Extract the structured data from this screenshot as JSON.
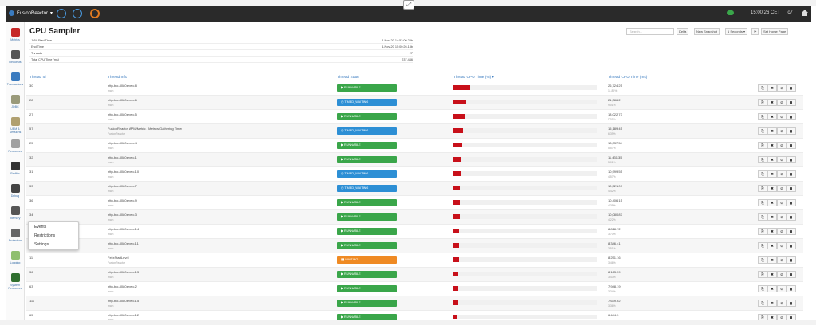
{
  "topbar": {
    "app_name": "FusionReactor",
    "clock": "15:00:26 CET",
    "user": "ic7"
  },
  "sidebar": {
    "items": [
      {
        "label": "Metrics",
        "icon": "metrics-icon",
        "color": "#c62828"
      },
      {
        "label": "Requests",
        "icon": "requests-icon",
        "color": "#555555"
      },
      {
        "label": "Transactions",
        "icon": "transactions-icon",
        "color": "#3a7bbf"
      },
      {
        "label": "JDBC",
        "icon": "jdbc-icon",
        "color": "#9a9a7a"
      },
      {
        "label": "UEM & Sessions",
        "icon": "uem-icon",
        "color": "#b0a070"
      },
      {
        "label": "Resources",
        "icon": "resources-icon",
        "color": "#a0a0a0"
      },
      {
        "label": "Profiler",
        "icon": "profiler-icon",
        "color": "#333333"
      },
      {
        "label": "Debug",
        "icon": "debug-icon",
        "color": "#444444"
      },
      {
        "label": "Memory",
        "icon": "memory-icon",
        "color": "#555555"
      },
      {
        "label": "Protection",
        "icon": "protection-icon",
        "color": "#666666"
      },
      {
        "label": "Logging",
        "icon": "logging-icon",
        "color": "#8fbf6f"
      },
      {
        "label": "System Resources",
        "icon": "system-resources-icon",
        "color": "#2f6f2f"
      }
    ]
  },
  "page": {
    "title": "CPU Sampler",
    "search_placeholder": "Search...",
    "toolbar": {
      "delta": "Delta",
      "new_snapshot": "New Snapshot",
      "interval": "1 Seconds ▾",
      "refresh": "⟳",
      "set_home": "Set Home Page"
    }
  },
  "stats": [
    {
      "label": "JVM Start Time",
      "value": "4-Nov-20 14:53:00.23b"
    },
    {
      "label": "End Time",
      "value": "4-Nov-20 15:00:26.13b"
    },
    {
      "label": "Threads",
      "value": "27"
    },
    {
      "label": "Total CPU Time (ms)",
      "value": "237,446"
    }
  ],
  "table": {
    "headers": {
      "thread_id": "Thread Id",
      "thread_info": "Thread Info",
      "thread_state": "Thread State",
      "thread_cpu_pct": "Thread CPU Time (%) ▾",
      "thread_cpu_ms": "Thread CPU Time (ms)"
    },
    "rows": [
      {
        "id": "30",
        "name": "http-bio-8080-exec-8",
        "group": "main",
        "state": "RUNNABLE",
        "state_kind": "run",
        "pct": 0.119,
        "time": "26,724.25",
        "pct_label": "11.85%"
      },
      {
        "id": "28",
        "name": "http-bio-8080-exec-6",
        "group": "main",
        "state": "TIMED_WAITING",
        "state_kind": "tw",
        "pct": 0.09,
        "time": "21,386.2",
        "pct_label": "9.01%"
      },
      {
        "id": "27",
        "name": "http-bio-8080-exec-5",
        "group": "main",
        "state": "RUNNABLE",
        "state_kind": "run",
        "pct": 0.08,
        "time": "18,022.73",
        "pct_label": "7.99%"
      },
      {
        "id": "57",
        "name": "FusionReactor APM/Metric - Metrics Gathering Timer",
        "group": "FusionReactor",
        "state": "TIMED_WAITING",
        "state_kind": "tw",
        "pct": 0.067,
        "time": "15,189.45",
        "pct_label": "6.39%"
      },
      {
        "id": "25",
        "name": "http-bio-8080-exec-4",
        "group": "main",
        "state": "RUNNABLE",
        "state_kind": "run",
        "pct": 0.059,
        "time": "13,337.54",
        "pct_label": "5.57%"
      },
      {
        "id": "32",
        "name": "http-bio-8080-exec-1",
        "group": "main",
        "state": "RUNNABLE",
        "state_kind": "run",
        "pct": 0.051,
        "time": "11,431.35",
        "pct_label": "5.01%"
      },
      {
        "id": "31",
        "name": "http-bio-8080-exec-10",
        "group": "main",
        "state": "TIMED_WAITING",
        "state_kind": "tw",
        "pct": 0.049,
        "time": "10,999.55",
        "pct_label": "4.57%"
      },
      {
        "id": "33",
        "name": "http-bio-8080-exec-7",
        "group": "main",
        "state": "TIMED_WAITING",
        "state_kind": "tw",
        "pct": 0.047,
        "time": "10,521.09",
        "pct_label": "4.42%"
      },
      {
        "id": "36",
        "name": "http-bio-8080-exec-9",
        "group": "main",
        "state": "RUNNABLE",
        "state_kind": "run",
        "pct": 0.047,
        "time": "10,406.15",
        "pct_label": "4.39%"
      },
      {
        "id": "34",
        "name": "http-bio-8080-exec-3",
        "group": "main",
        "state": "RUNNABLE",
        "state_kind": "run",
        "pct": 0.045,
        "time": "10,080.87",
        "pct_label": "4.22%"
      },
      {
        "id": "39",
        "name": "http-bio-8080-exec-14",
        "group": "main",
        "state": "RUNNABLE",
        "state_kind": "run",
        "pct": 0.039,
        "time": "8,818.72",
        "pct_label": "3.70%"
      },
      {
        "id": "33",
        "name": "http-bio-8080-exec-11",
        "group": "main",
        "state": "RUNNABLE",
        "state_kind": "run",
        "pct": 0.037,
        "time": "8,346.41",
        "pct_label": "3.51%"
      },
      {
        "id": "11",
        "name": "FelixStartLevel",
        "group": "FusionReactor",
        "state": "WAITING",
        "state_kind": "wait",
        "pct": 0.037,
        "time": "8,251.16",
        "pct_label": "3.46%"
      },
      {
        "id": "36",
        "name": "http-bio-8080-exec-13",
        "group": "main",
        "state": "RUNNABLE",
        "state_kind": "run",
        "pct": 0.036,
        "time": "8,163.59",
        "pct_label": "3.43%"
      },
      {
        "id": "63",
        "name": "http-bio-8080-exec-2",
        "group": "main",
        "state": "RUNNABLE",
        "state_kind": "run",
        "pct": 0.035,
        "time": "7,948.19",
        "pct_label": "3.34%"
      },
      {
        "id": "111",
        "name": "http-bio-8080-exec-15",
        "group": "main",
        "state": "RUNNABLE",
        "state_kind": "run",
        "pct": 0.034,
        "time": "7,639.62",
        "pct_label": "3.36%"
      },
      {
        "id": "65",
        "name": "http-bio-8080-exec-12",
        "group": "main",
        "state": "RUNNABLE",
        "state_kind": "run",
        "pct": 0.028,
        "time": "6,444.3",
        "pct_label": ""
      }
    ]
  },
  "row_actions": [
    "⎘",
    "✖",
    "⊘",
    "▮"
  ],
  "popup": {
    "items": [
      "Events",
      "Restrictions",
      "Settings"
    ]
  },
  "colors": {
    "runnable": "#3aa64a",
    "timed_waiting": "#2d8fd5",
    "waiting": "#ef8a23",
    "cpu_bar": "#c8101a",
    "header_text": "#3a7bbf"
  }
}
